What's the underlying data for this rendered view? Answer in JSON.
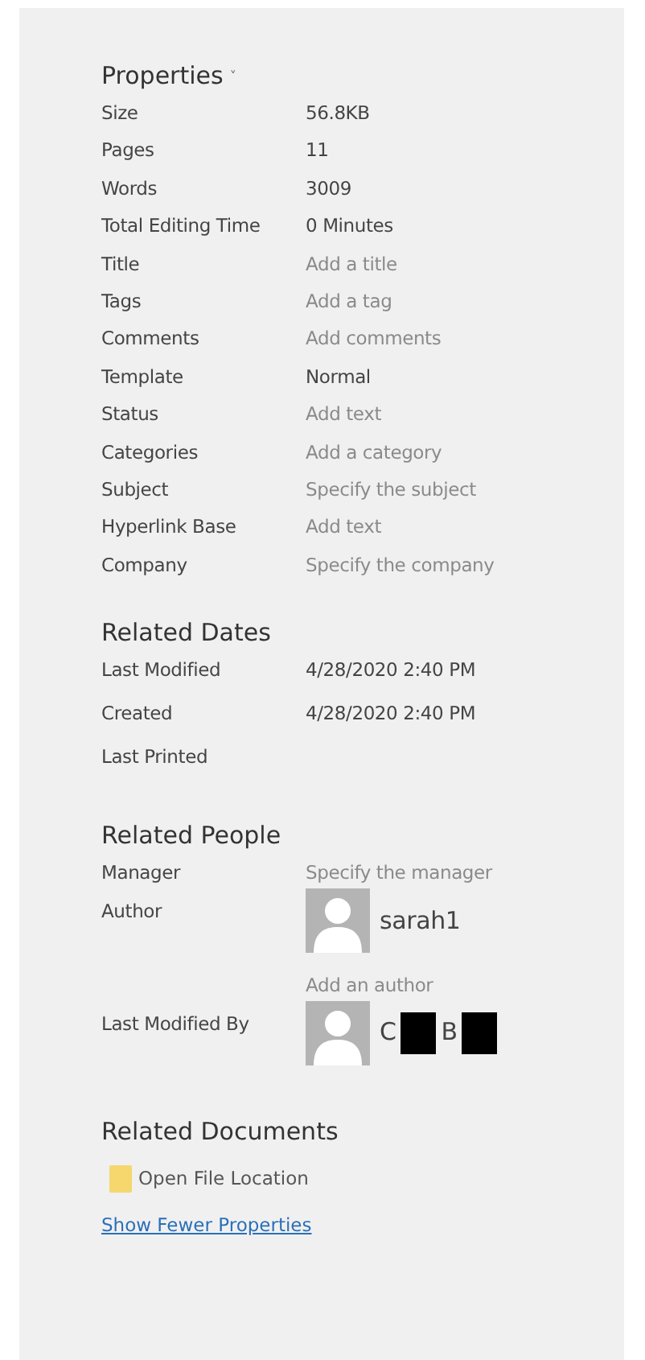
{
  "properties": {
    "title": "Properties",
    "caret": "˅",
    "rows": [
      {
        "label": "Size",
        "value": "56.8KB"
      },
      {
        "label": "Pages",
        "value": "11"
      },
      {
        "label": "Words",
        "value": "3009"
      },
      {
        "label": "Total Editing Time",
        "value": "0 Minutes"
      },
      {
        "label": "Title",
        "placeholder": "Add a title"
      },
      {
        "label": "Tags",
        "placeholder": "Add a tag"
      },
      {
        "label": "Comments",
        "placeholder": "Add comments"
      },
      {
        "label": "Template",
        "value": "Normal"
      },
      {
        "label": "Status",
        "placeholder": "Add text"
      },
      {
        "label": "Categories",
        "placeholder": "Add a category"
      },
      {
        "label": "Subject",
        "placeholder": "Specify the subject"
      },
      {
        "label": "Hyperlink Base",
        "placeholder": "Add text"
      },
      {
        "label": "Company",
        "placeholder": "Specify the company"
      }
    ]
  },
  "related_dates": {
    "title": "Related Dates",
    "rows": [
      {
        "label": "Last Modified",
        "value": "4/28/2020 2:40 PM"
      },
      {
        "label": "Created",
        "value": "4/28/2020 2:40 PM"
      },
      {
        "label": "Last Printed"
      }
    ]
  },
  "related_people": {
    "title": "Related People",
    "manager": {
      "label": "Manager",
      "placeholder": "Specify the manager"
    },
    "author": {
      "label": "Author",
      "name_parts": [
        "sarah1"
      ],
      "redacted": false,
      "add_placeholder": "Add an author"
    },
    "last_modified_by": {
      "label": "Last Modified By",
      "name_parts": [
        "C",
        "B"
      ],
      "redacted": true
    }
  },
  "related_documents": {
    "title": "Related Documents",
    "open_location": "Open File Location"
  },
  "show_fewer": "Show Fewer Properties"
}
